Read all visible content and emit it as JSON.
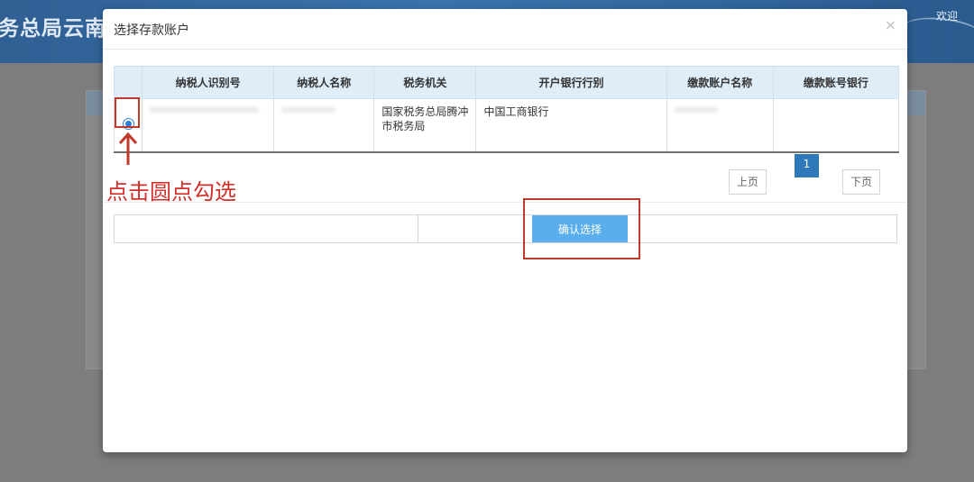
{
  "header": {
    "title": "务总局云南",
    "welcome": "欢迎"
  },
  "modal": {
    "title": "选择存款账户",
    "close": "×",
    "table": {
      "columns": [
        "",
        "纳税人识别号",
        "纳税人名称",
        "税务机关",
        "开户银行行别",
        "缴款账户名称",
        "缴款账号银行"
      ],
      "rows": [
        {
          "selected": true,
          "taxpayer_id": "********************",
          "taxpayer_name": "**********",
          "tax_authority": "国家税务总局腾冲市税务局",
          "bank_type": "中国工商银行",
          "account_name": "********",
          "account_bank": ""
        }
      ]
    },
    "pagination": {
      "prev": "上页",
      "current": "1",
      "next": "下页"
    },
    "confirm": "确认选择"
  },
  "annotation": {
    "text": "点击圆点勾选",
    "color": "#d0302a"
  },
  "colors": {
    "accent": "#5aaeeb",
    "page_active": "#2f78b9",
    "highlight": "#c0392b"
  }
}
